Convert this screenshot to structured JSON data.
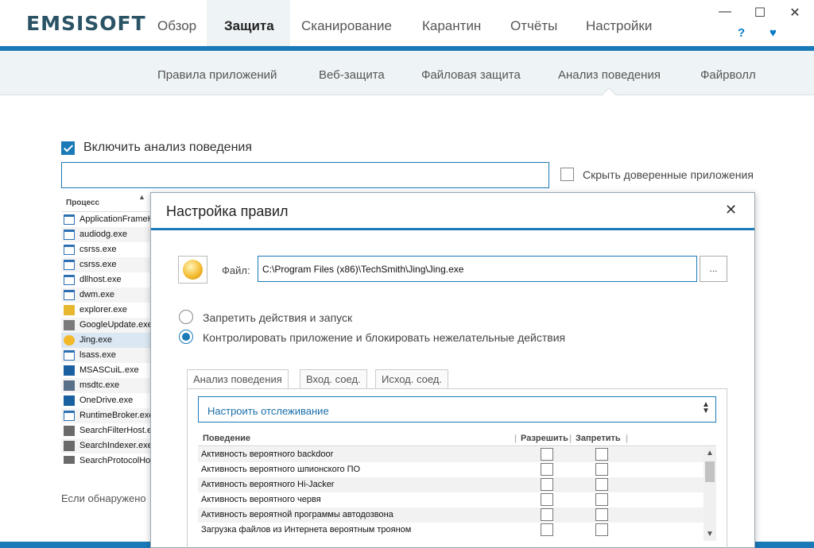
{
  "app": {
    "logo": "EMSISOFT"
  },
  "main_tabs": [
    "Обзор",
    "Защита",
    "Сканирование",
    "Карантин",
    "Отчёты",
    "Настройки"
  ],
  "window_controls": {
    "minimize": "—",
    "maximize": "☐",
    "close": "✕"
  },
  "header_icons": {
    "help": "?",
    "heart": "♥"
  },
  "sub_tabs": [
    "Правила приложений",
    "Веб-защита",
    "Файловая защита",
    "Анализ поведения",
    "Файрволл"
  ],
  "page": {
    "enable_label": "Включить анализ поведения",
    "search_value": "",
    "hide_trusted_label": "Скрыть доверенные приложения",
    "process_header": "Процесс",
    "footer_text": "Если обнаружено"
  },
  "processes": [
    {
      "name": "ApplicationFrameHost.exe",
      "icon": "window-icon"
    },
    {
      "name": "audiodg.exe",
      "icon": "window-icon"
    },
    {
      "name": "csrss.exe",
      "icon": "window-icon"
    },
    {
      "name": "csrss.exe",
      "icon": "window-icon"
    },
    {
      "name": "dllhost.exe",
      "icon": "window-icon"
    },
    {
      "name": "dwm.exe",
      "icon": "window-icon"
    },
    {
      "name": "explorer.exe",
      "icon": "folder-icon"
    },
    {
      "name": "GoogleUpdate.exe",
      "icon": "google-update-icon"
    },
    {
      "name": "Jing.exe",
      "icon": "jing-icon"
    },
    {
      "name": "lsass.exe",
      "icon": "window-icon"
    },
    {
      "name": "MSASCuiL.exe",
      "icon": "shield-icon"
    },
    {
      "name": "msdtc.exe",
      "icon": "network-icon"
    },
    {
      "name": "OneDrive.exe",
      "icon": "cloud-icon"
    },
    {
      "name": "RuntimeBroker.exe",
      "icon": "window-icon"
    },
    {
      "name": "SearchFilterHost.exe",
      "icon": "search-icon"
    },
    {
      "name": "SearchIndexer.exe",
      "icon": "search-icon"
    },
    {
      "name": "SearchProtocolHost.exe",
      "icon": "search-icon"
    }
  ],
  "dialog": {
    "title": "Настройка правил",
    "close": "✕",
    "file_label": "Файл:",
    "file_path": "C:\\Program Files (x86)\\TechSmith\\Jing\\Jing.exe",
    "browse_label": "...",
    "radio_block": "Запретить действия и запуск",
    "radio_monitor": "Контролировать приложение и блокировать нежелательные действия",
    "tabs": [
      "Анализ поведения",
      "Вход. соед.",
      "Исход. соед."
    ],
    "monitor_select": "Настроить отслеживание",
    "col_behavior": "Поведение",
    "col_allow": "Разрешить",
    "col_deny": "Запретить",
    "behaviors": [
      "Активность вероятного backdoor",
      "Активность вероятного шпионского ПО",
      "Активность вероятного Hi-Jacker",
      "Активность вероятного червя",
      "Активность вероятной программы автодозвона",
      "Загрузка файлов из Интернета вероятным трояном"
    ]
  },
  "colors": {
    "accent": "#1a7ab8",
    "subbar": "#eef3f5"
  }
}
